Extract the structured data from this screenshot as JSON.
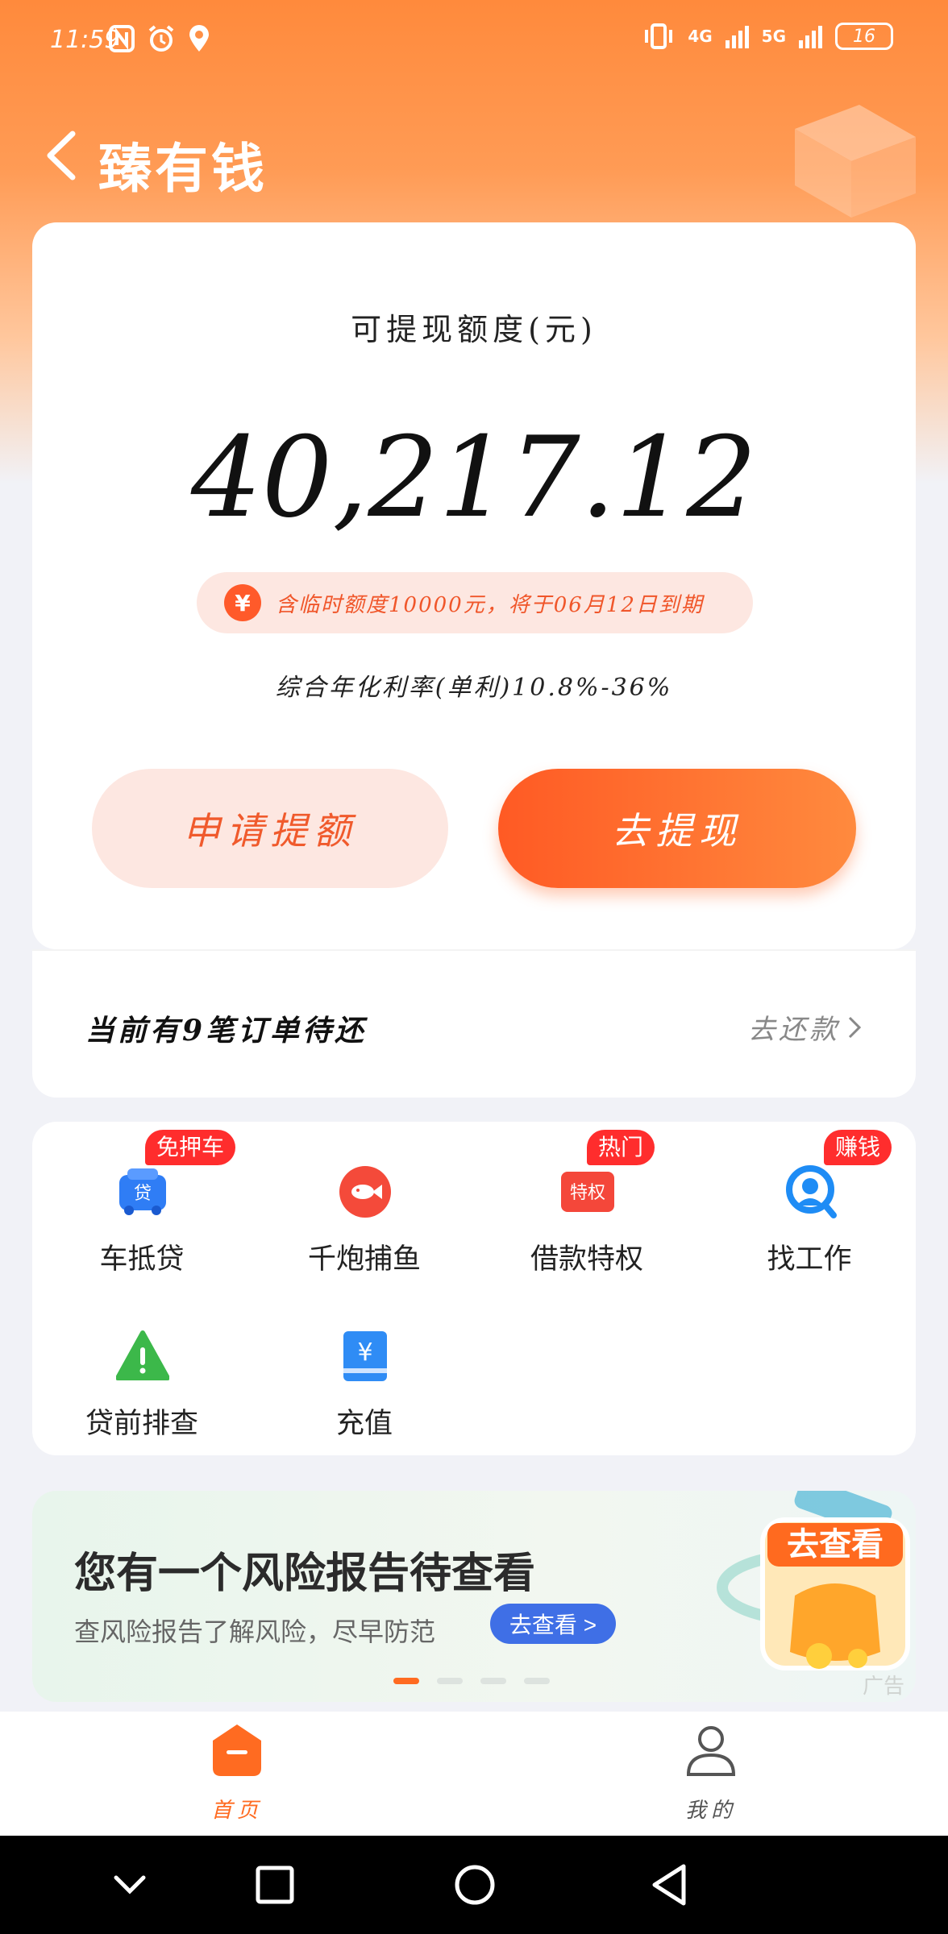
{
  "status_bar": {
    "time": "11:59",
    "battery": "16",
    "net1": "4G",
    "net2": "5G"
  },
  "header": {
    "title": "臻有钱"
  },
  "credit_card": {
    "label": "可提现额度(元)",
    "amount": "40,217.12",
    "notice": "含临时额度10000元，将于06月12日到期",
    "rate": "综合年化利率(单利)10.8%-36%",
    "apply_button": "申请提额",
    "withdraw_button": "去提现"
  },
  "pending": {
    "text": "当前有9笔订单待还",
    "repay_link": "去还款"
  },
  "services": [
    {
      "label": "车抵贷",
      "tag": "免押车",
      "icon": "car-loan-icon"
    },
    {
      "label": "千炮捕鱼",
      "tag": "",
      "icon": "fish-icon"
    },
    {
      "label": "借款特权",
      "tag": "热门",
      "icon": "privilege-icon",
      "icon_text": "特权"
    },
    {
      "label": "找工作",
      "tag": "赚钱",
      "icon": "job-search-icon"
    },
    {
      "label": "贷前排查",
      "tag": "",
      "icon": "warning-icon"
    },
    {
      "label": "充值",
      "tag": "",
      "icon": "recharge-icon"
    }
  ],
  "ad": {
    "title": "您有一个风险报告待查看",
    "subtitle": "查风险报告了解风险，尽早防范",
    "button": "去查看 >",
    "gift_text": "去查看",
    "label": "广告",
    "dots": 4,
    "active_dot": 0
  },
  "tabs": [
    {
      "label": "首页",
      "active": true
    },
    {
      "label": "我的",
      "active": false
    }
  ],
  "colors": {
    "accent": "#ff6b21",
    "tag_red": "#ff2d2d",
    "ad_button": "#3f6fe6"
  }
}
